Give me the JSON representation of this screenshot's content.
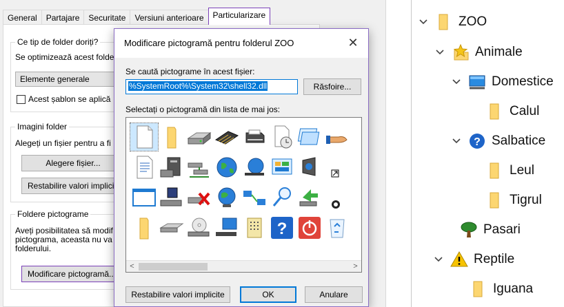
{
  "properties": {
    "tabs": [
      {
        "label": "General"
      },
      {
        "label": "Partajare"
      },
      {
        "label": "Securitate"
      },
      {
        "label": "Versiuni anterioare"
      },
      {
        "label": "Particularizare",
        "active": true
      }
    ],
    "folder_type": {
      "title": "Ce tip de folder doriți?",
      "optimize_text": "Se optimizează acest folde",
      "selected_option": "Elemente generale",
      "template_checkbox_label": "Acest șablon se aplică"
    },
    "folder_images": {
      "title": "Imagini folder",
      "description": "Alegeți un fișier pentru a fi",
      "choose_file_button": "Alegere fișier...",
      "restore_button": "Restabilire valori implicite"
    },
    "folder_icons": {
      "title": "Foldere pictograme",
      "description_lines": [
        "Aveți posibilitatea să modif",
        "pictograma, aceasta nu va",
        "folderului."
      ],
      "change_icon_button": "Modificare pictogramă..."
    }
  },
  "dialog": {
    "title": "Modificare pictogramă pentru folderul ZOO",
    "close_glyph": "✕",
    "search_label": "Se caută pictograme în acest fișier:",
    "path_value": "%SystemRoot%\\System32\\shell32.dll",
    "browse_button": "Răsfoire...",
    "list_label": "Selectați o pictogramă din lista de mai jos:",
    "icons": [
      [
        "blank-document-icon",
        "folder-icon",
        "hard-drive-icon",
        "memory-chip-icon",
        "printer-icon",
        "document-clock-icon",
        "window-stack-icon",
        "hand-share-icon"
      ],
      [
        "text-document-icon",
        "computer-drive-icon",
        "network-drives-icon",
        "globe-icon",
        "network-globe-icon",
        "control-panel-icon",
        "speaker-icon",
        "shortcut-arrow-icon"
      ],
      [
        "blank-window-icon",
        "floppy-drive-icon",
        "drive-error-icon",
        "network-globe-icon",
        "network-computers-icon",
        "magnifier-icon",
        "green-arrow-drive-icon",
        "clock-small-icon"
      ],
      [
        "folder-icon",
        "disk-drive-icon",
        "cd-drive-icon",
        "monitor-icon",
        "keypad-icon",
        "help-icon",
        "power-icon",
        "recycle-bin-icon"
      ]
    ],
    "scroll_left": "<",
    "scroll_right": ">",
    "restore_button": "Restabilire valori implicite",
    "ok_button": "OK",
    "cancel_button": "Anulare"
  },
  "tree": {
    "items": [
      {
        "label": "ZOO",
        "icon": "folder-icon",
        "expanded": true,
        "level": 0
      },
      {
        "label": "Animale",
        "icon": "star-icon",
        "expanded": true,
        "level": 1
      },
      {
        "label": "Domestice",
        "icon": "monitor-icon",
        "expanded": true,
        "level": 2
      },
      {
        "label": "Calul",
        "icon": "folder-icon",
        "expanded": null,
        "level": 3
      },
      {
        "label": "Salbatice",
        "icon": "help-icon",
        "expanded": true,
        "level": 2
      },
      {
        "label": "Leul",
        "icon": "folder-icon",
        "expanded": null,
        "level": 3
      },
      {
        "label": "Tigrul",
        "icon": "folder-icon",
        "expanded": null,
        "level": 3
      },
      {
        "label": "Pasari",
        "icon": "tree-icon",
        "expanded": null,
        "level": 2
      },
      {
        "label": "Reptile",
        "icon": "warning-icon",
        "expanded": true,
        "level": 2
      },
      {
        "label": "Iguana",
        "icon": "folder-icon",
        "expanded": null,
        "level": 3
      }
    ]
  },
  "colors": {
    "accent": "#0078d7",
    "tab_active_border": "#7a3fb8",
    "folder": "#fcd671",
    "help_blue": "#1e64c8",
    "power_red": "#e0443a",
    "warning_yellow": "#f7c300"
  }
}
